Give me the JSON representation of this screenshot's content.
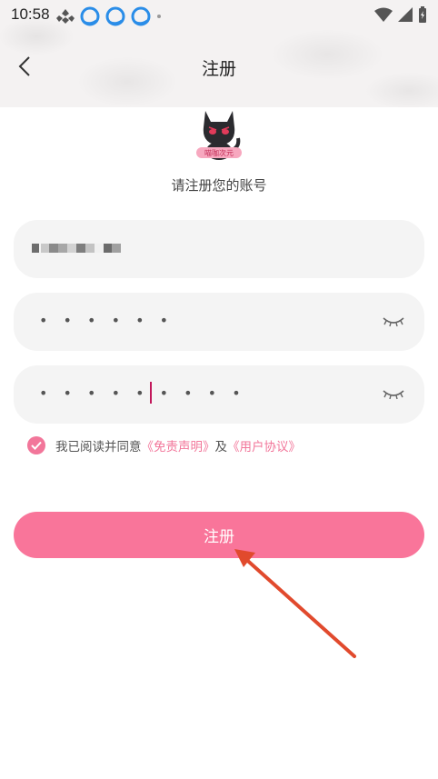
{
  "status_bar": {
    "time": "10:58"
  },
  "nav": {
    "title": "注册"
  },
  "avatar": {
    "badge_text": "喵咖次元"
  },
  "subtitle": "请注册您的账号",
  "form": {
    "password_value": "• • • • • •",
    "confirm_password_value": "• • • • • • • • •"
  },
  "agreement": {
    "prefix": "我已阅读并同意",
    "disclaimer_link": "《免责声明》",
    "and": "及",
    "user_agreement_link": "《用户协议》"
  },
  "register_button_label": "注册",
  "colors": {
    "accent": "#f9759a",
    "arrow": "#e14a2d"
  }
}
